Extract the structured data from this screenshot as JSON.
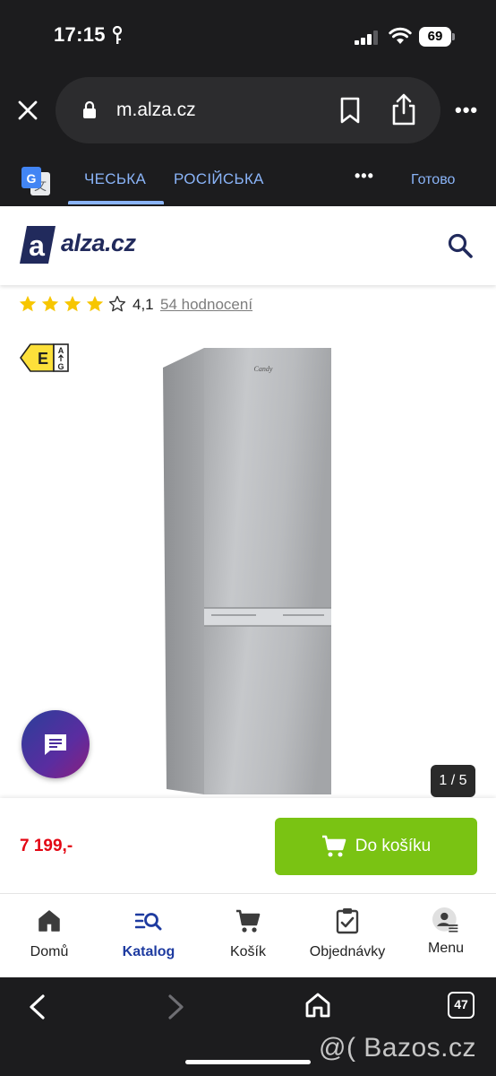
{
  "status_bar": {
    "time": "17:15",
    "battery": "69"
  },
  "browser": {
    "url": "m.alza.cz",
    "more_label": "•••"
  },
  "translate_bar": {
    "tab_source": "ЧЕСЬКА",
    "tab_target": "РОСІЙСЬКА",
    "more_label": "•••",
    "done_label": "Готово"
  },
  "site": {
    "logo_letter": "a",
    "logo_text": "alza.cz"
  },
  "rating": {
    "stars": 4,
    "max_stars": 5,
    "value": "4,1",
    "reviews_link": "54 hodnocení"
  },
  "product": {
    "energy_class": "E",
    "energy_scale_top": "A",
    "energy_scale_bottom": "G",
    "brand_on_product": "Candy",
    "image_counter": "1 / 5"
  },
  "purchase": {
    "price": "7 199,-",
    "cart_button": "Do košíku"
  },
  "bottom_nav": {
    "items": [
      {
        "label": "Domů",
        "icon": "home-icon",
        "active": false
      },
      {
        "label": "Katalog",
        "icon": "catalog-search-icon",
        "active": true
      },
      {
        "label": "Košík",
        "icon": "cart-icon",
        "active": false
      },
      {
        "label": "Objednávky",
        "icon": "orders-clipboard-icon",
        "active": false
      },
      {
        "label": "Menu",
        "icon": "user-menu-icon",
        "active": false
      }
    ]
  },
  "safari_toolbar": {
    "tab_count": "47"
  },
  "watermark": "@( Bazos.cz",
  "colors": {
    "chrome_dark": "#1c1c1e",
    "link_blue": "#8ab4f8",
    "brand_navy": "#212a5c",
    "price_red": "#e30613",
    "cart_green": "#7ac313",
    "nav_active": "#1e3ba0",
    "star_yellow": "#f7c600"
  }
}
